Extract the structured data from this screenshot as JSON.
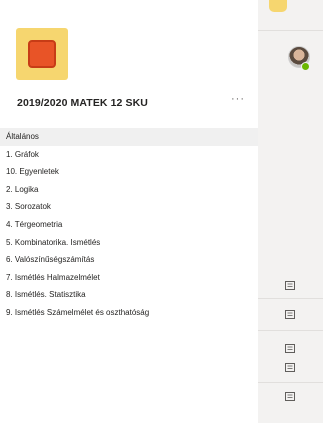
{
  "team": {
    "title": "2019/2020 MATEK 12 SKU",
    "more_label": "···",
    "logo_icon": "team-logo-icon",
    "logo_colors": {
      "background": "#f6d66f",
      "square": "#e85427"
    }
  },
  "channels": [
    {
      "label": "Általános",
      "active": true
    },
    {
      "label": "1. Gráfok"
    },
    {
      "label": "10. Egyenletek"
    },
    {
      "label": "2. Logika"
    },
    {
      "label": "3. Sorozatok"
    },
    {
      "label": "4. Térgeometria"
    },
    {
      "label": "5. Kombinatorika. Ismétlés"
    },
    {
      "label": "6. Valószínűségszámítás"
    },
    {
      "label": "7. Ismétlés Halmazelmélet"
    },
    {
      "label": "8. Ismétlés. Statisztika"
    },
    {
      "label": "9. Ismétlés Számelmélet és oszthatóság"
    }
  ],
  "right_panel": {
    "status_color": "#6bb700",
    "message_icons": [
      "message-icon",
      "message-icon",
      "message-icon",
      "message-icon",
      "message-icon"
    ]
  }
}
